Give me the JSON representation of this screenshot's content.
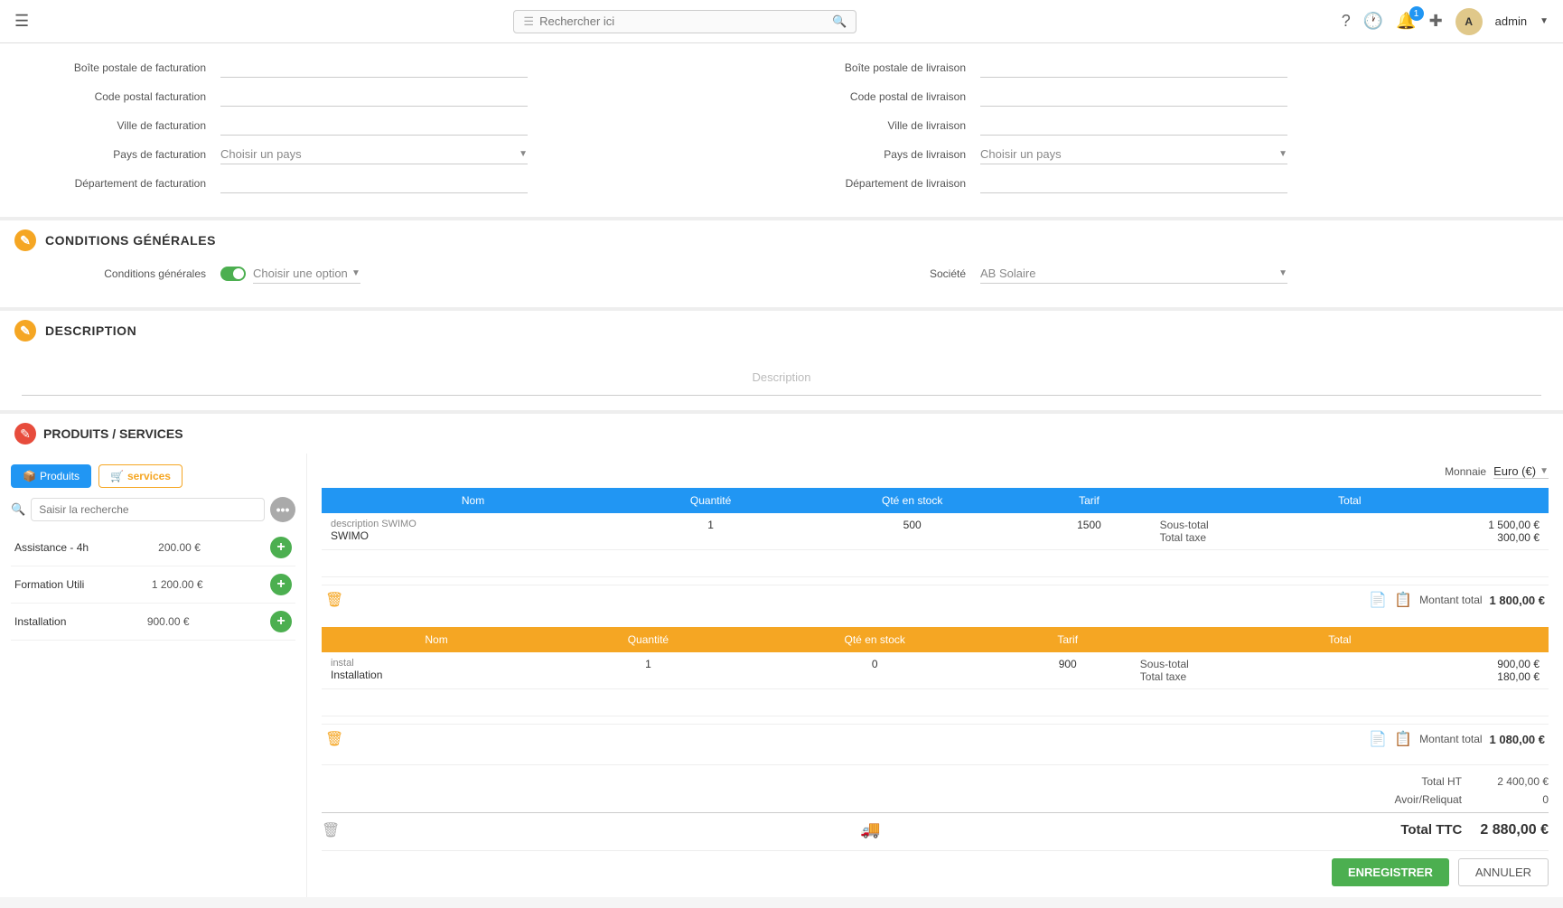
{
  "topbar": {
    "search_placeholder": "Rechercher ici",
    "admin_label": "admin",
    "notification_count": "1"
  },
  "billing": {
    "boite_postale_facturation_label": "Boîte postale de facturation",
    "code_postal_facturation_label": "Code postal facturation",
    "ville_facturation_label": "Ville de facturation",
    "pays_facturation_label": "Pays de facturation",
    "pays_facturation_placeholder": "Choisir un pays",
    "departement_facturation_label": "Département de facturation",
    "boite_postale_livraison_label": "Boîte postale de livraison",
    "code_postal_livraison_label": "Code postal de livraison",
    "ville_livraison_label": "Ville de livraison",
    "pays_livraison_label": "Pays de livraison",
    "pays_livraison_placeholder": "Choisir un pays",
    "departement_livraison_label": "Département de livraison"
  },
  "conditions": {
    "section_title": "Conditions Générales",
    "conditions_generales_label": "Conditions générales",
    "choisir_option_placeholder": "Choisir une option",
    "societe_label": "Société",
    "societe_value": "AB Solaire"
  },
  "description": {
    "section_title": "Description",
    "placeholder": "Description"
  },
  "products": {
    "section_title": "Produits / Services",
    "tab_produits": "Produits",
    "tab_services": "services",
    "search_placeholder": "Saisir la recherche",
    "monnaie_label": "Monnaie",
    "monnaie_value": "Euro (€)",
    "services": [
      {
        "name": "Assistance - 4h",
        "price": "200.00 €"
      },
      {
        "name": "Formation Utili",
        "price": "1 200.00 €"
      },
      {
        "name": "Installation",
        "price": "900.00 €"
      }
    ],
    "table_blue": {
      "columns": [
        "Nom",
        "Quantité",
        "Qté en stock",
        "Tarif",
        "Total"
      ],
      "rows": [
        {
          "description": "description SWIMO",
          "nom": "SWIMO",
          "quantite": "1",
          "qte_stock": "500",
          "tarif": "1500",
          "sous_total": "1 500,00 €",
          "total_taxe": "300,00 €"
        }
      ],
      "montant_total_label": "Montant total",
      "montant_total_value": "1 800,00 €",
      "sous_total_label": "Sous-total",
      "total_taxe_label": "Total taxe"
    },
    "table_orange": {
      "columns": [
        "Nom",
        "Quantité",
        "Qté en stock",
        "Tarif",
        "Total"
      ],
      "rows": [
        {
          "description": "instal",
          "nom": "Installation",
          "quantite": "1",
          "qte_stock": "0",
          "tarif": "900",
          "sous_total": "900,00 €",
          "total_taxe": "180,00 €"
        }
      ],
      "montant_total_label": "Montant total",
      "montant_total_value": "1 080,00 €",
      "sous_total_label": "Sous-total",
      "total_taxe_label": "Total taxe"
    },
    "total_ht_label": "Total HT",
    "total_ht_value": "2 400,00 €",
    "avoir_reliquat_label": "Avoir/Reliquat",
    "avoir_reliquat_value": "0",
    "total_ttc_label": "Total TTC",
    "total_ttc_value": "2 880,00 €",
    "btn_enregistrer": "ENREGISTRER",
    "btn_annuler": "ANNULER"
  }
}
